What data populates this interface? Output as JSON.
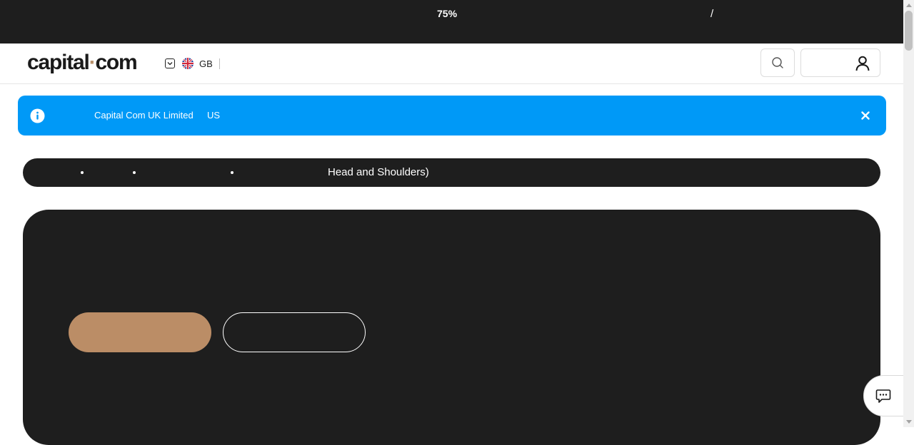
{
  "risk_banner": {
    "percentage": "75%",
    "separator": "/"
  },
  "header": {
    "logo": {
      "part1": "capital",
      "dot": "·",
      "part2": "com"
    },
    "language": {
      "code": "GB",
      "flag_icon": "uk-flag-icon"
    },
    "icons": {
      "search": "search-icon",
      "account": "user-icon"
    }
  },
  "notice": {
    "entity": "Capital Com UK Limited",
    "region": "US",
    "icons": {
      "info": "info-icon",
      "close": "close-icon"
    }
  },
  "breadcrumb": {
    "current": "Head and Shoulders)"
  },
  "hero": {
    "primary_color": "#bb8d66"
  },
  "chat": {
    "icon": "chat-icon"
  },
  "colors": {
    "dark": "#1e1e1e",
    "notice_blue": "#0099f7",
    "accent": "#bb8d66"
  }
}
